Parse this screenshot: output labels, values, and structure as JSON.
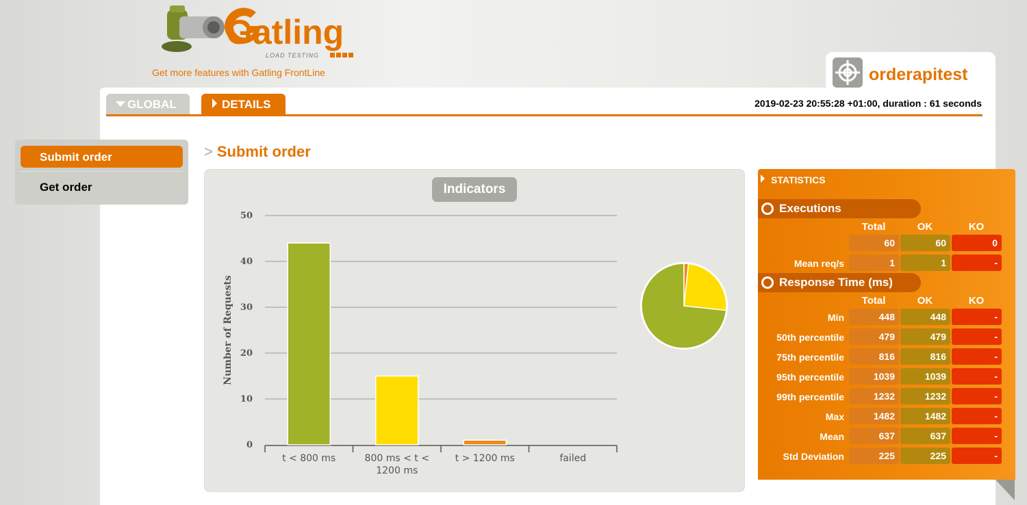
{
  "header": {
    "logo_text": "Gatling",
    "logo_subtext": "LOAD TESTING",
    "frontline_link": "Get more features with Gatling FrontLine"
  },
  "simulation": {
    "name": "orderapitest",
    "icon": "target-icon"
  },
  "tabs": {
    "global": "GLOBAL",
    "details": "DETAILS"
  },
  "run_info": "2019-02-23 20:55:28 +01:00, duration : 61 seconds",
  "menu": {
    "items": [
      {
        "label": "Submit order",
        "active": true
      },
      {
        "label": "Get order",
        "active": false
      }
    ]
  },
  "page": {
    "title": "Submit order"
  },
  "indicators": {
    "title": "Indicators"
  },
  "chart_data": {
    "type": "bar",
    "categories": [
      "t < 800 ms",
      "800 ms < t < 1200 ms",
      "t > 1200 ms",
      "failed"
    ],
    "values": [
      44,
      15,
      1,
      0
    ],
    "colors": [
      "#a0b228",
      "#ffdd00",
      "#f08a12",
      "#e83200"
    ],
    "ylabel": "Number of Requests",
    "ylim": [
      0,
      50
    ],
    "yticks": [
      0,
      10,
      20,
      30,
      40,
      50
    ],
    "grid": true,
    "pie": {
      "values": [
        44,
        15,
        1,
        0
      ],
      "colors": [
        "#a0b228",
        "#ffdd00",
        "#f08a12",
        "#e83200"
      ]
    }
  },
  "statistics": {
    "title": "STATISTICS",
    "executions": {
      "title": "Executions",
      "headers": [
        "Total",
        "OK",
        "KO"
      ],
      "rows": [
        {
          "label": "",
          "total": "60",
          "ok": "60",
          "ko": "0"
        },
        {
          "label": "Mean req/s",
          "total": "1",
          "ok": "1",
          "ko": "-"
        }
      ]
    },
    "response_time": {
      "title": "Response Time (ms)",
      "headers": [
        "Total",
        "OK",
        "KO"
      ],
      "rows": [
        {
          "label": "Min",
          "total": "448",
          "ok": "448",
          "ko": "-"
        },
        {
          "label": "50th percentile",
          "total": "479",
          "ok": "479",
          "ko": "-"
        },
        {
          "label": "75th percentile",
          "total": "816",
          "ok": "816",
          "ko": "-"
        },
        {
          "label": "95th percentile",
          "total": "1039",
          "ok": "1039",
          "ko": "-"
        },
        {
          "label": "99th percentile",
          "total": "1232",
          "ok": "1232",
          "ko": "-"
        },
        {
          "label": "Max",
          "total": "1482",
          "ok": "1482",
          "ko": "-"
        },
        {
          "label": "Mean",
          "total": "637",
          "ok": "637",
          "ko": "-"
        },
        {
          "label": "Std Deviation",
          "total": "225",
          "ok": "225",
          "ko": "-"
        }
      ]
    }
  }
}
